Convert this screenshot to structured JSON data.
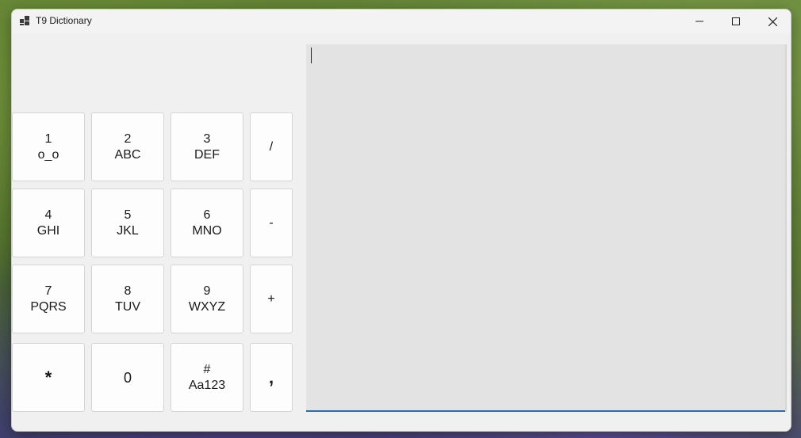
{
  "window": {
    "title": "T9 Dictionary",
    "icon": "app-window-icon"
  },
  "title_controls": {
    "minimize": "minimize-icon",
    "maximize": "maximize-icon",
    "close": "close-icon"
  },
  "keypad": {
    "k1": {
      "digit": "1",
      "letters": "o_o"
    },
    "k2": {
      "digit": "2",
      "letters": "ABC"
    },
    "k3": {
      "digit": "3",
      "letters": "DEF"
    },
    "slash": {
      "label": "/"
    },
    "k4": {
      "digit": "4",
      "letters": "GHI"
    },
    "k5": {
      "digit": "5",
      "letters": "JKL"
    },
    "k6": {
      "digit": "6",
      "letters": "MNO"
    },
    "minus": {
      "label": "-"
    },
    "k7": {
      "digit": "7",
      "letters": "PQRS"
    },
    "k8": {
      "digit": "8",
      "letters": "TUV"
    },
    "k9": {
      "digit": "9",
      "letters": "WXYZ"
    },
    "plus": {
      "label": "+"
    },
    "star": {
      "label": "*"
    },
    "k0": {
      "label": "0"
    },
    "hash": {
      "symbol": "#",
      "mode": "Aa123"
    },
    "comma": {
      "label": ","
    }
  },
  "editor": {
    "value": ""
  }
}
